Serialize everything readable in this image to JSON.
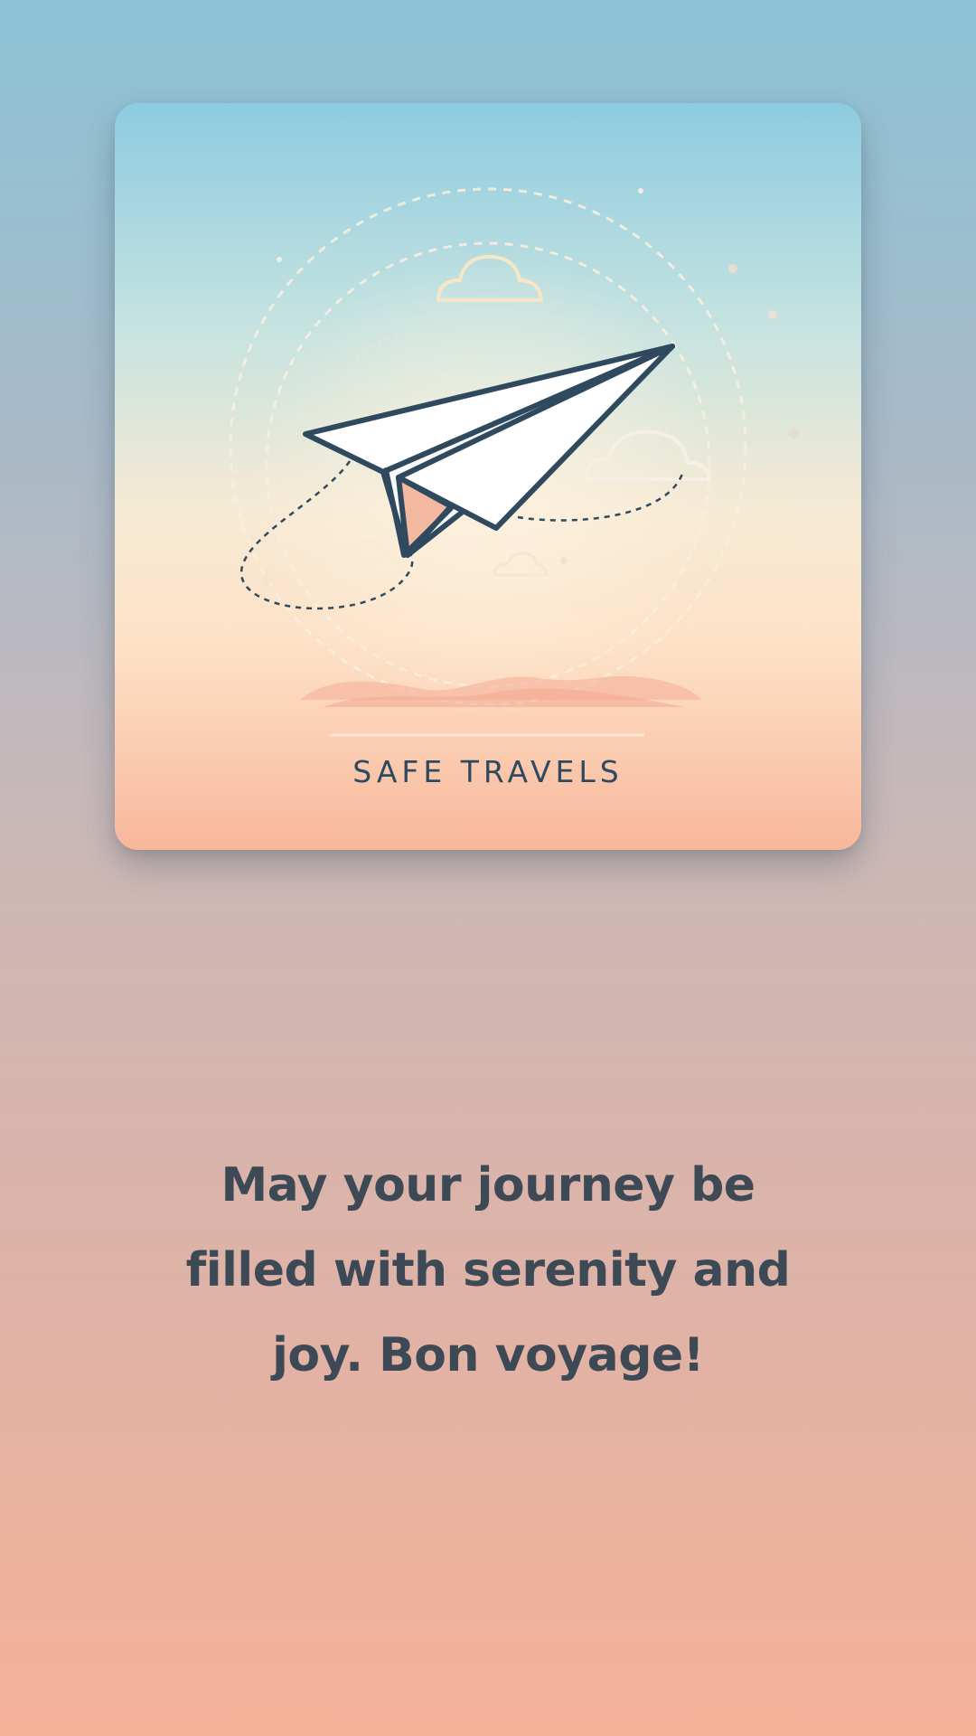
{
  "card": {
    "image_name": "paper-plane-illustration",
    "caption": "SAFE TRAVELS"
  },
  "message": {
    "text": "May your journey be filled with serenity and joy. Bon voyage!"
  },
  "colors": {
    "text_dark": "#3d4a55",
    "plane_outline": "#2f4a5e",
    "bg_top": "#8cc3d6",
    "bg_bottom": "#f4b198"
  }
}
